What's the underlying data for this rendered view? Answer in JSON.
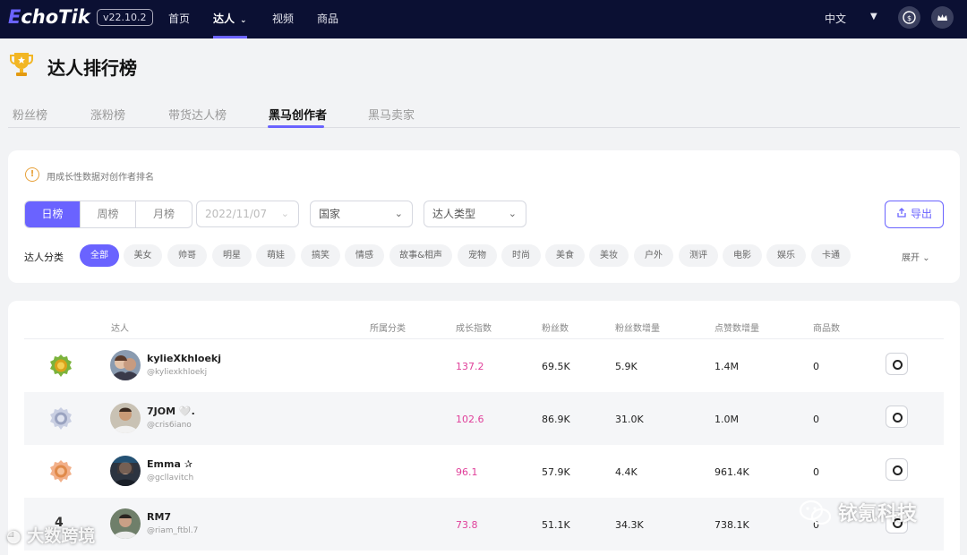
{
  "nav": {
    "logo_first": "E",
    "logo_rest": "choTik",
    "version": "v22.10.2",
    "items": [
      "首页",
      "达人",
      "视频",
      "商品"
    ],
    "active_index": 1,
    "language": "中文"
  },
  "page": {
    "title": "达人排行榜"
  },
  "tabs": [
    "粉丝榜",
    "涨粉榜",
    "带货达人榜",
    "黑马创作者",
    "黑马卖家"
  ],
  "active_tab": 3,
  "filters": {
    "info": "用成长性数据对创作者排名",
    "period": [
      "日榜",
      "周榜",
      "月榜"
    ],
    "active_period": 0,
    "date_placeholder": "2022/11/07",
    "country_placeholder": "国家",
    "type_placeholder": "达人类型",
    "export_label": "导出",
    "category_label": "达人分类",
    "categories": [
      "全部",
      "美女",
      "帅哥",
      "明星",
      "萌娃",
      "搞笑",
      "情感",
      "故事&相声",
      "宠物",
      "时尚",
      "美食",
      "美妆",
      "户外",
      "测评",
      "电影",
      "娱乐",
      "卡通"
    ],
    "active_category": 0,
    "expand_label": "展开"
  },
  "table": {
    "headers": [
      "达人",
      "所属分类",
      "成长指数",
      "粉丝数",
      "粉丝数增量",
      "点赞数增量",
      "商品数"
    ],
    "rows": [
      {
        "rank": "1",
        "name": "kylieXkhloekj",
        "handle": "@kyliexkhloekj",
        "category": "",
        "growth": "137.2",
        "fans": "69.5K",
        "fans_delta": "5.9K",
        "likes_delta": "1.4M",
        "products": "0"
      },
      {
        "rank": "2",
        "name": "7JOM 🤍.",
        "handle": "@cris6iano",
        "category": "",
        "growth": "102.6",
        "fans": "86.9K",
        "fans_delta": "31.0K",
        "likes_delta": "1.0M",
        "products": "0"
      },
      {
        "rank": "3",
        "name": "Emma ✰",
        "handle": "@gcllavitch",
        "category": "",
        "growth": "96.1",
        "fans": "57.9K",
        "fans_delta": "4.4K",
        "likes_delta": "961.4K",
        "products": "0"
      },
      {
        "rank": "4",
        "name": "RM7",
        "handle": "@riam_ftbl.7",
        "category": "",
        "growth": "73.8",
        "fans": "51.1K",
        "fans_delta": "34.3K",
        "likes_delta": "738.1K",
        "products": "0"
      }
    ]
  },
  "watermarks": {
    "left": "大数跨境",
    "right": "铱氪科技"
  },
  "colors": {
    "accent": "#6a63ff",
    "nav_bg": "#0b1033",
    "growth": "#e0409a",
    "gold": "#d9a21a",
    "silver": "#9aa3c0",
    "bronze": "#e08a4a"
  }
}
